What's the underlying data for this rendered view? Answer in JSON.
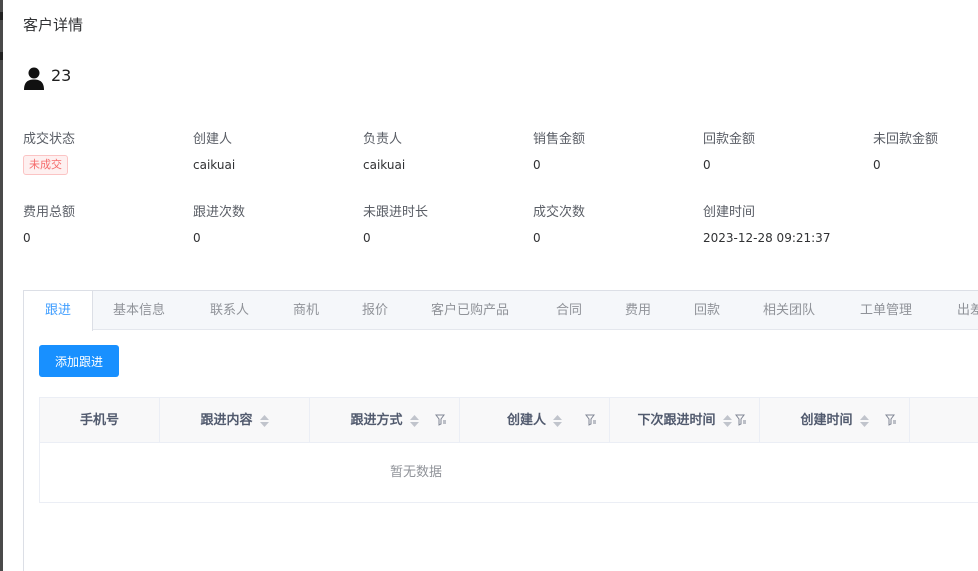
{
  "page": {
    "title": "客户详情"
  },
  "customer": {
    "name": "23"
  },
  "fields": [
    {
      "label": "成交状态",
      "value": "未成交",
      "badge": true
    },
    {
      "label": "创建人",
      "value": "caikuai"
    },
    {
      "label": "负责人",
      "value": "caikuai"
    },
    {
      "label": "销售金额",
      "value": "0"
    },
    {
      "label": "回款金额",
      "value": "0"
    },
    {
      "label": "未回款金额",
      "value": "0"
    },
    {
      "label": "费用总额",
      "value": "0"
    },
    {
      "label": "跟进次数",
      "value": "0"
    },
    {
      "label": "未跟进时长",
      "value": "0"
    },
    {
      "label": "成交次数",
      "value": "0"
    },
    {
      "label": "创建时间",
      "value": "2023-12-28 09:21:37"
    }
  ],
  "tabs": [
    {
      "label": "跟进",
      "active": true
    },
    {
      "label": "基本信息"
    },
    {
      "label": "联系人"
    },
    {
      "label": "商机"
    },
    {
      "label": "报价"
    },
    {
      "label": "客户已购产品"
    },
    {
      "label": "合同"
    },
    {
      "label": "费用"
    },
    {
      "label": "回款"
    },
    {
      "label": "相关团队"
    },
    {
      "label": "工单管理"
    },
    {
      "label": "出差"
    }
  ],
  "actions": {
    "add_followup": "添加跟进"
  },
  "table": {
    "columns": [
      {
        "label": "手机号",
        "sortable": false,
        "filterable": false
      },
      {
        "label": "跟进内容",
        "sortable": true,
        "filterable": false
      },
      {
        "label": "跟进方式",
        "sortable": true,
        "filterable": true
      },
      {
        "label": "创建人",
        "sortable": true,
        "filterable": true
      },
      {
        "label": "下次跟进时间",
        "sortable": true,
        "filterable": true
      },
      {
        "label": "创建时间",
        "sortable": true,
        "filterable": true
      },
      {
        "label": "",
        "sortable": false,
        "filterable": false
      }
    ],
    "empty_text": "暂无数据"
  },
  "colors": {
    "primary": "#1890ff",
    "tab_active": "#409eff",
    "badge_text": "#f56c6c",
    "badge_bg": "#fef0f0"
  },
  "icons": {
    "customer": "user-icon",
    "sort": "sort-caret-icon",
    "filter": "filter-icon"
  }
}
